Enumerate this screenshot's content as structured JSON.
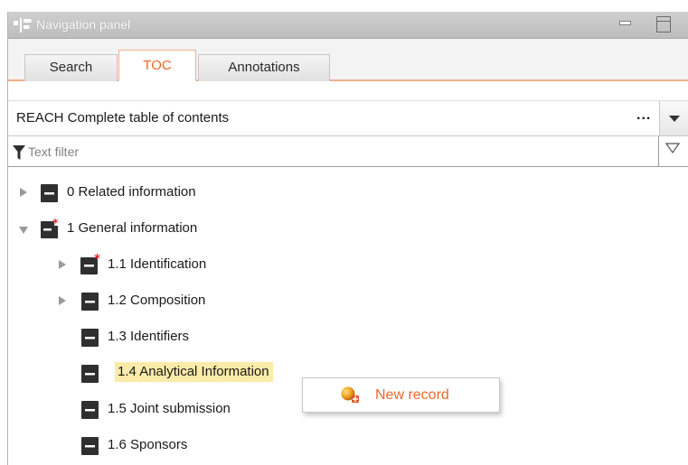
{
  "titlebar": {
    "title": "Navigation panel"
  },
  "tabs": [
    {
      "label": "Search",
      "active": false
    },
    {
      "label": "TOC",
      "active": true
    },
    {
      "label": "Annotations",
      "active": false
    }
  ],
  "toc_selector": {
    "value": "REACH Complete table of contents",
    "more": "..."
  },
  "filter": {
    "placeholder": "Text filter",
    "value": ""
  },
  "tree": [
    {
      "label": "0 Related information",
      "expander": "collapsed",
      "required": false
    },
    {
      "label": "1 General information",
      "expander": "expanded",
      "required": true
    },
    {
      "label": "1.1 Identification",
      "expander": "collapsed",
      "required": true
    },
    {
      "label": "1.2 Composition",
      "expander": "collapsed",
      "required": false
    },
    {
      "label": "1.3 Identifiers",
      "expander": "none",
      "required": false
    },
    {
      "label": "1.4 Analytical Information",
      "expander": "none",
      "required": false,
      "selected": true
    },
    {
      "label": "1.5 Joint submission",
      "expander": "none",
      "required": false
    },
    {
      "label": "1.6 Sponsors",
      "expander": "none",
      "required": false
    }
  ],
  "context_menu": {
    "items": [
      {
        "label": "New record",
        "icon": "new-record-icon"
      }
    ]
  },
  "colors": {
    "accent": "#e8682a",
    "selection": "#fbeba8",
    "tab_border": "#f0b08a",
    "required_star": "#d9262c"
  }
}
